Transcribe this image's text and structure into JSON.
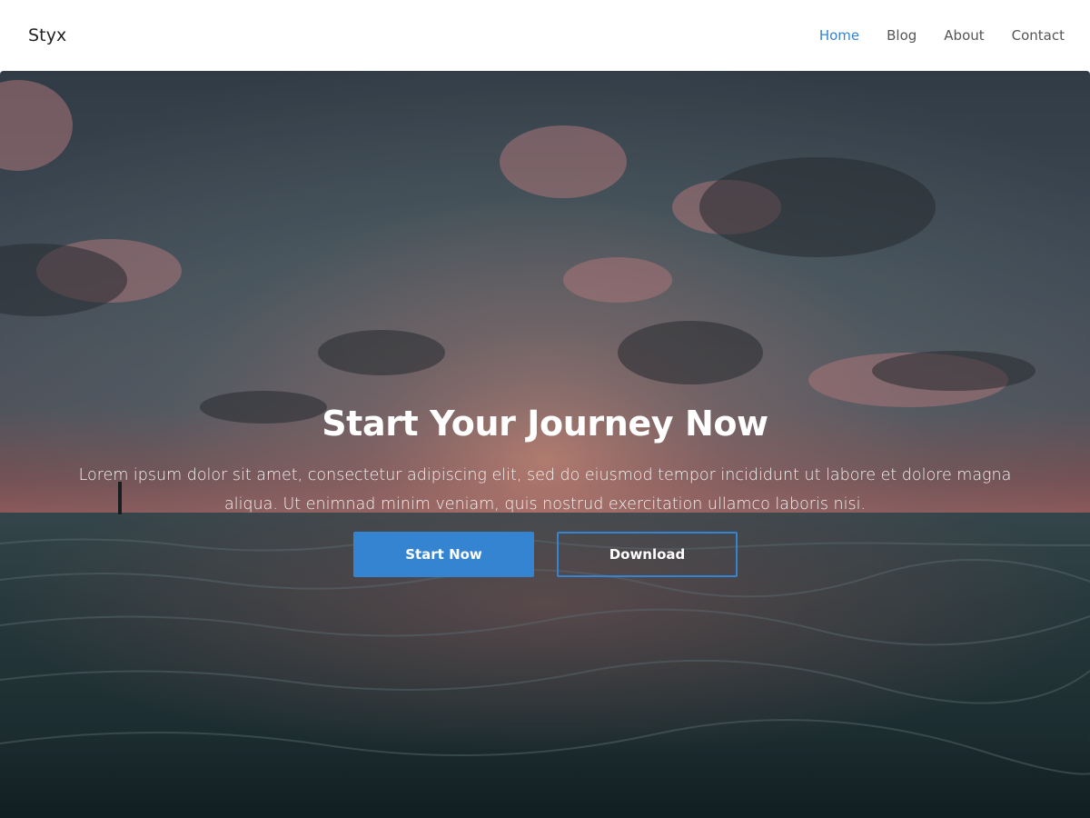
{
  "navbar": {
    "brand": "Styx",
    "links": [
      {
        "label": "Home",
        "active": true
      },
      {
        "label": "Blog",
        "active": false
      },
      {
        "label": "About",
        "active": false
      },
      {
        "label": "Contact",
        "active": false
      }
    ]
  },
  "hero": {
    "title": "Start Your Journey Now",
    "text": "Lorem ipsum dolor sit amet, consectetur adipiscing elit, sed do eiusmod tempor incididunt ut labore et dolore magna aliqua. Ut enimnad minim veniam, quis nostrud exercitation ullamco laboris nisi.",
    "primary_button": "Start Now",
    "secondary_button": "Download"
  },
  "colors": {
    "accent": "#3584d1",
    "brand_text": "#222222",
    "nav_text": "#555555"
  }
}
